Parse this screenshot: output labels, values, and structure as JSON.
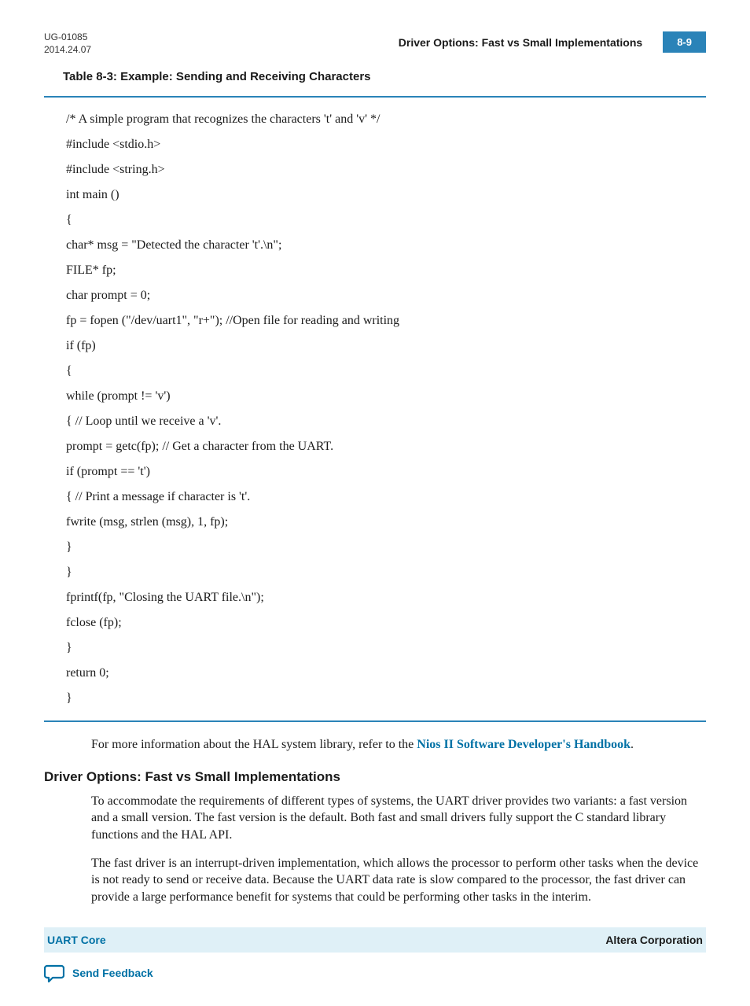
{
  "header": {
    "doc_id_line1": "UG-01085",
    "doc_id_line2": "2014.24.07",
    "title": "Driver Options: Fast vs Small Implementations",
    "page_number": "8-9"
  },
  "table_caption": "Table 8-3: Example: Sending and Receiving Characters",
  "code_lines": [
    "/* A simple program that recognizes the characters 't' and 'v' */",
    "#include <stdio.h>",
    "#include <string.h>",
    "int main ()",
    "{",
    "char* msg = \"Detected the character 't'.\\n\";",
    "FILE* fp;",
    "char prompt = 0;",
    "fp = fopen (\"/dev/uart1\", \"r+\"); //Open file for reading and writing",
    "if (fp)",
    "{",
    "while (prompt != 'v')",
    "{ // Loop until we receive a 'v'.",
    "prompt = getc(fp); // Get a character from the UART.",
    "if (prompt == 't')",
    "{ // Print a message if character is 't'.",
    "fwrite (msg, strlen (msg), 1, fp);",
    "}",
    "}",
    "fprintf(fp, \"Closing the UART file.\\n\");",
    "fclose (fp);",
    "}",
    "return 0;",
    "}"
  ],
  "info_prefix": "For more information about the HAL system library, refer to the ",
  "info_link": "Nios II Software Developer's Handbook",
  "info_suffix": ".",
  "section": {
    "heading": "Driver Options: Fast vs Small Implementations",
    "para1": "To accommodate the requirements of different types of systems, the UART driver provides two variants: a fast version and a small version. The fast version is the default. Both fast and small drivers fully support the C standard library functions and the HAL API.",
    "para2": "The fast driver is an interrupt-driven implementation, which allows the processor to perform other tasks when the device is not ready to send or receive data. Because the UART data rate is slow compared to the processor, the fast driver can provide a large performance benefit for systems that could be performing other tasks in the interim."
  },
  "footer": {
    "left": "UART Core",
    "right": "Altera Corporation",
    "feedback": "Send Feedback"
  }
}
